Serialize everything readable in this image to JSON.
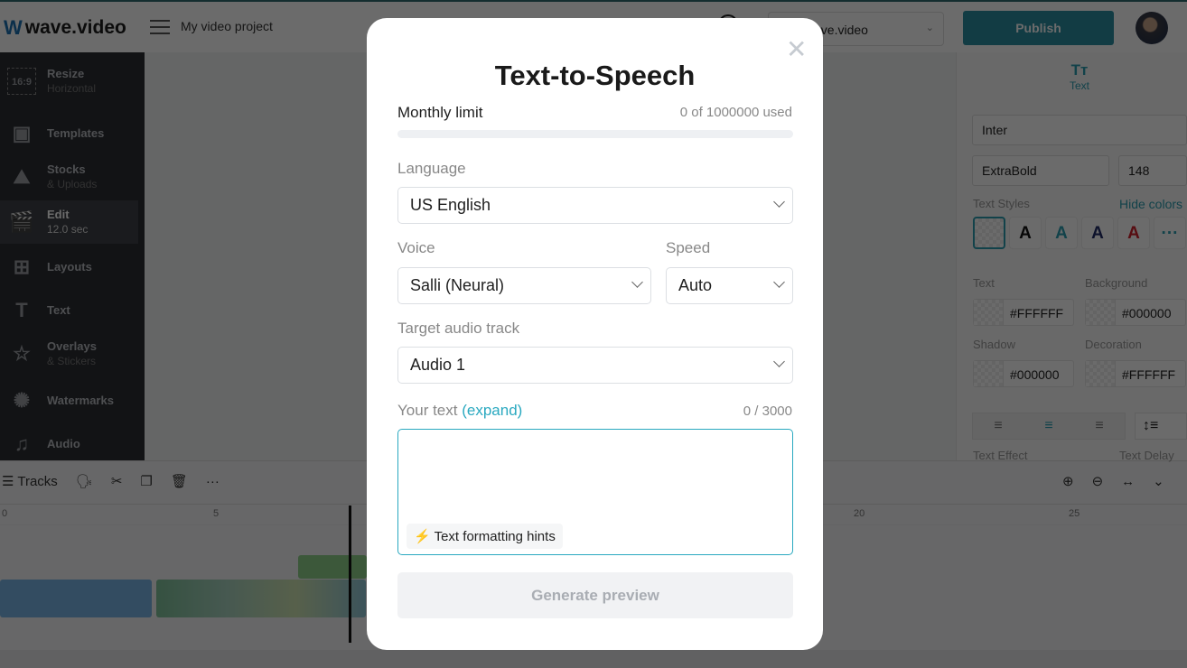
{
  "header": {
    "logo": "wave.video",
    "project": "My video project",
    "workspace": "ave.video",
    "publish": "Publish"
  },
  "sidebar": {
    "items": [
      {
        "label": "Resize",
        "sub": "Horizontal",
        "icon": "aspect-ratio-icon",
        "glyph": "16:9"
      },
      {
        "label": "Templates",
        "sub": "",
        "icon": "templates-icon",
        "glyph": "▣"
      },
      {
        "label": "Stocks",
        "sub": "& Uploads",
        "icon": "image-icon",
        "glyph": "⛰"
      },
      {
        "label": "Edit",
        "sub": "12.0 sec",
        "icon": "clapperboard-icon",
        "glyph": "🎬"
      },
      {
        "label": "Layouts",
        "sub": "",
        "icon": "layouts-icon",
        "glyph": "⊞"
      },
      {
        "label": "Text",
        "sub": "",
        "icon": "text-icon",
        "glyph": "T"
      },
      {
        "label": "Overlays",
        "sub": "& Stickers",
        "icon": "star-icon",
        "glyph": "☆"
      },
      {
        "label": "Watermarks",
        "sub": "",
        "icon": "watermark-icon",
        "glyph": "✺"
      },
      {
        "label": "Audio",
        "sub": "",
        "icon": "music-icon",
        "glyph": "♫"
      }
    ]
  },
  "right_panel": {
    "tab_glyph": "Tт",
    "tab": "Text",
    "font": "Inter",
    "weight": "ExtraBold",
    "size": "148",
    "text_styles": "Text Styles",
    "hide_colors": "Hide colors",
    "style_letters": [
      "A",
      "A",
      "A",
      "A"
    ],
    "style_colors": [
      "#111111",
      "#2a9db0",
      "#1e2a66",
      "#d0202a"
    ],
    "colors": [
      {
        "label": "Text",
        "value": "#FFFFFF"
      },
      {
        "label": "Background",
        "value": "#000000"
      },
      {
        "label": "Shadow",
        "value": "#000000"
      },
      {
        "label": "Decoration",
        "value": "#FFFFFF"
      }
    ],
    "text_effect": "Text Effect",
    "text_delay": "Text Delay"
  },
  "timeline": {
    "tracks": "Tracks",
    "ruler": [
      "0",
      "5",
      "20",
      "25"
    ]
  },
  "modal": {
    "title": "Text-to-Speech",
    "monthly_limit": "Monthly limit",
    "usage": "0 of 1000000 used",
    "usage_fraction": 0,
    "language_label": "Language",
    "language": "US English",
    "voice_label": "Voice",
    "voice": "Salli (Neural)",
    "speed_label": "Speed",
    "speed": "Auto",
    "track_label": "Target audio track",
    "track": "Audio 1",
    "text_label": "Your text",
    "expand": "(expand)",
    "counter": "0 / 3000",
    "text_value": "",
    "hints": "Text formatting hints",
    "generate": "Generate preview",
    "accent": "#2aa9c0"
  }
}
